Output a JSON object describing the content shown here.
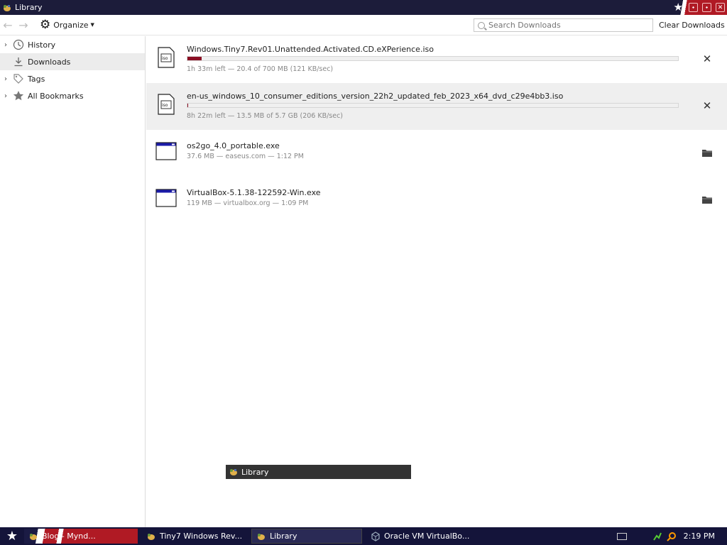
{
  "window": {
    "title": "Library"
  },
  "toolbar": {
    "organize_label": "Organize",
    "search_placeholder": "Search Downloads",
    "clear_label": "Clear Downloads"
  },
  "sidebar": {
    "items": [
      {
        "label": "History",
        "icon": "clock-icon",
        "expandable": true,
        "selected": false
      },
      {
        "label": "Downloads",
        "icon": "download-icon",
        "expandable": false,
        "selected": true
      },
      {
        "label": "Tags",
        "icon": "tag-icon",
        "expandable": true,
        "selected": false
      },
      {
        "label": "All Bookmarks",
        "icon": "star-icon",
        "expandable": true,
        "selected": false
      }
    ]
  },
  "downloads": [
    {
      "name": "Windows.Tiny7.Rev01.Unattended.Activated.CD.eXPerience.iso",
      "status": "1h 33m left — 20.4 of 700 MB (121 KB/sec)",
      "progress": 0.029,
      "in_progress": true,
      "action": "cancel-icon"
    },
    {
      "name": "en-us_windows_10_consumer_editions_version_22h2_updated_feb_2023_x64_dvd_c29e4bb3.iso",
      "status": "8h 22m left — 13.5 MB of 5.7 GB (206 KB/sec)",
      "progress": 0.002,
      "in_progress": true,
      "action": "cancel-icon"
    },
    {
      "name": "os2go_4.0_portable.exe",
      "status": "37.6 MB — easeus.com — 1:12 PM",
      "in_progress": false,
      "action": "folder-icon"
    },
    {
      "name": "VirtualBox-5.1.38-122592-Win.exe",
      "status": "119 MB — virtualbox.org — 1:09 PM",
      "in_progress": false,
      "action": "folder-icon"
    }
  ],
  "tooltip": {
    "label": "Library"
  },
  "taskbar": {
    "tasks": [
      {
        "label": "Blog - Mynd..."
      },
      {
        "label": "Tiny7 Windows Rev..."
      },
      {
        "label": "Library"
      },
      {
        "label": "Oracle VM VirtualBo..."
      }
    ],
    "clock": "2:19 PM"
  },
  "colors": {
    "progress_fill": "#8b0f24",
    "titlebar": "#1c1c3a",
    "taskbar": "#14143a"
  }
}
